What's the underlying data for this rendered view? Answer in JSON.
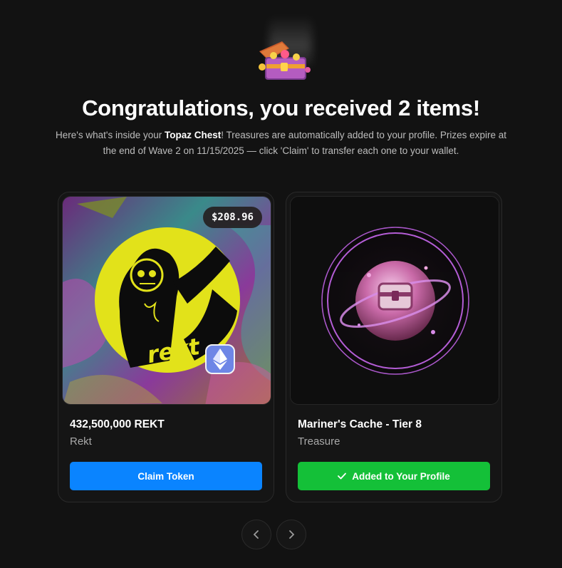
{
  "header": {
    "icon": "treasure-chest-icon",
    "title": "Congratulations, you received 2 items!",
    "subtitle_before": "Here's what's inside your ",
    "subtitle_bold": "Topaz Chest",
    "subtitle_after": "! Treasures are automatically added to your profile. Prizes expire at the end of Wave 2 on 11/15/2025 — click 'Claim' to transfer each one to your wallet."
  },
  "items": [
    {
      "price": "$208.96",
      "image_text": "rekt",
      "chain_icon": "ethereum-icon",
      "name": "432,500,000 REKT",
      "subtitle": "Rekt",
      "button_label": "Claim Token",
      "button_color": "#0a84ff"
    },
    {
      "name": "Mariner's Cache - Tier 8",
      "subtitle": "Treasure",
      "button_icon": "checkmark-icon",
      "button_label": "Added to Your Profile",
      "button_color": "#14c038"
    }
  ],
  "pagination": {
    "prev_icon": "chevron-left-icon",
    "next_icon": "chevron-right-icon"
  },
  "colors": {
    "background": "#121212",
    "card": "#151515",
    "accent_yellow": "#e2e21a",
    "orb_purple": "#b45dd6"
  }
}
